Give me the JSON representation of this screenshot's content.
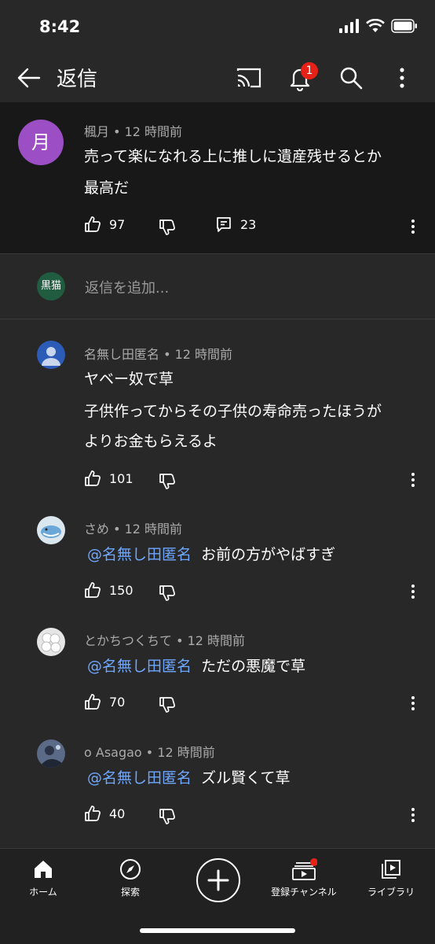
{
  "status": {
    "time": "8:42"
  },
  "header": {
    "title": "返信",
    "notification_count": "1"
  },
  "parent_comment": {
    "avatar_letter": "月",
    "meta": "楓月 • 12 時間前",
    "lines": [
      "売って楽になれる上に推しに遺産残せるとか",
      "最高だ"
    ],
    "likes": "97",
    "replies": "23"
  },
  "reply_input": {
    "avatar_text": "黒猫",
    "placeholder": "返信を追加..."
  },
  "replies": [
    {
      "meta": "名無し田匿名 • 12 時間前",
      "lines": [
        "ヤベー奴で草",
        "子供作ってからその子供の寿命売ったほうが",
        "よりお金もらえるよ"
      ],
      "likes": "101"
    },
    {
      "meta": "さめ • 12 時間前",
      "mention": "@名無し田匿名",
      "text": "お前の方がやばすぎ",
      "likes": "150"
    },
    {
      "meta": "とかちつくちて • 12 時間前",
      "mention": "@名無し田匿名",
      "text": "ただの悪魔で草",
      "likes": "70"
    },
    {
      "meta": "o Asagao • 12 時間前",
      "mention": "@名無し田匿名",
      "text": "ズル賢くて草",
      "likes": "40"
    }
  ],
  "nav": {
    "home": "ホーム",
    "explore": "探索",
    "subscriptions": "登録チャンネル",
    "library": "ライブラリ"
  }
}
